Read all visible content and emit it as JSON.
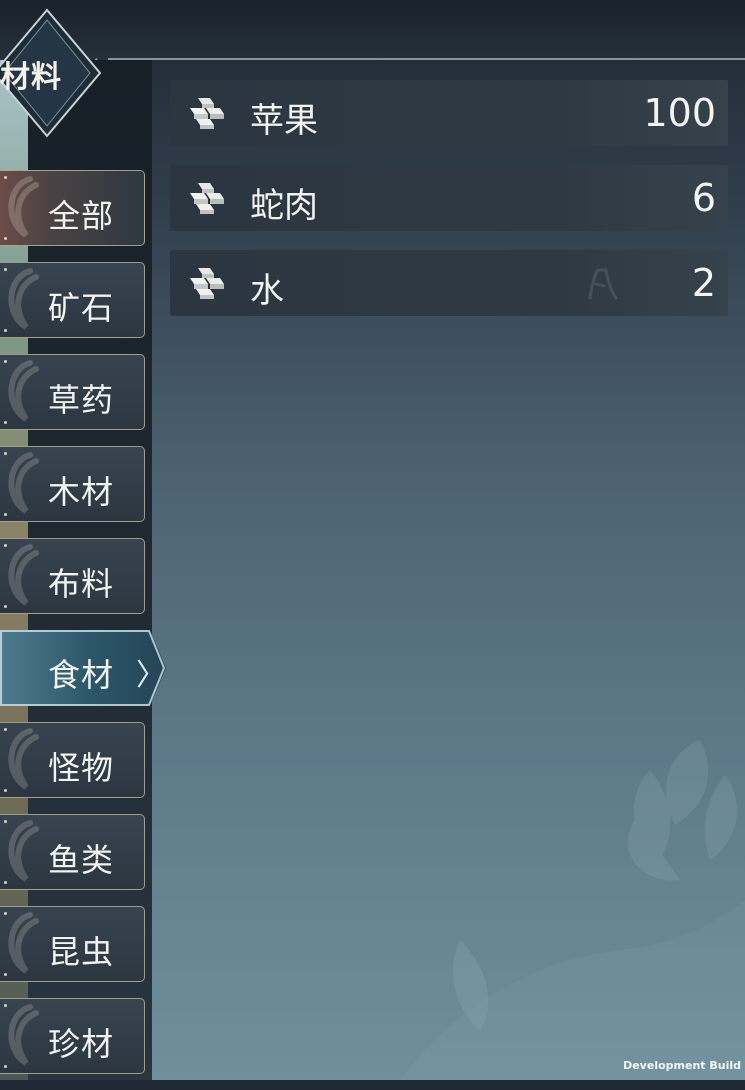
{
  "header": {
    "category_title": "材料"
  },
  "sidebar": {
    "tabs": [
      {
        "label": "全部"
      },
      {
        "label": "矿石"
      },
      {
        "label": "草药"
      },
      {
        "label": "木材"
      },
      {
        "label": "布料"
      },
      {
        "label": "食材",
        "active": true,
        "chevron": "〉"
      },
      {
        "label": "怪物"
      },
      {
        "label": "鱼类"
      },
      {
        "label": "昆虫"
      },
      {
        "label": "珍材"
      }
    ]
  },
  "items": [
    {
      "icon": "ingot-stack-icon",
      "name": "苹果",
      "quantity": "100"
    },
    {
      "icon": "ingot-stack-icon",
      "name": "蛇肉",
      "quantity": "6"
    },
    {
      "icon": "ingot-stack-icon",
      "name": "水",
      "quantity": "2"
    }
  ],
  "footer": {
    "build_label": "Development Build"
  },
  "colors": {
    "active_tab": "#2c5669",
    "tab_border": "#c8bea0",
    "item_row": "#2b3641",
    "text": "#f3f3f0"
  }
}
